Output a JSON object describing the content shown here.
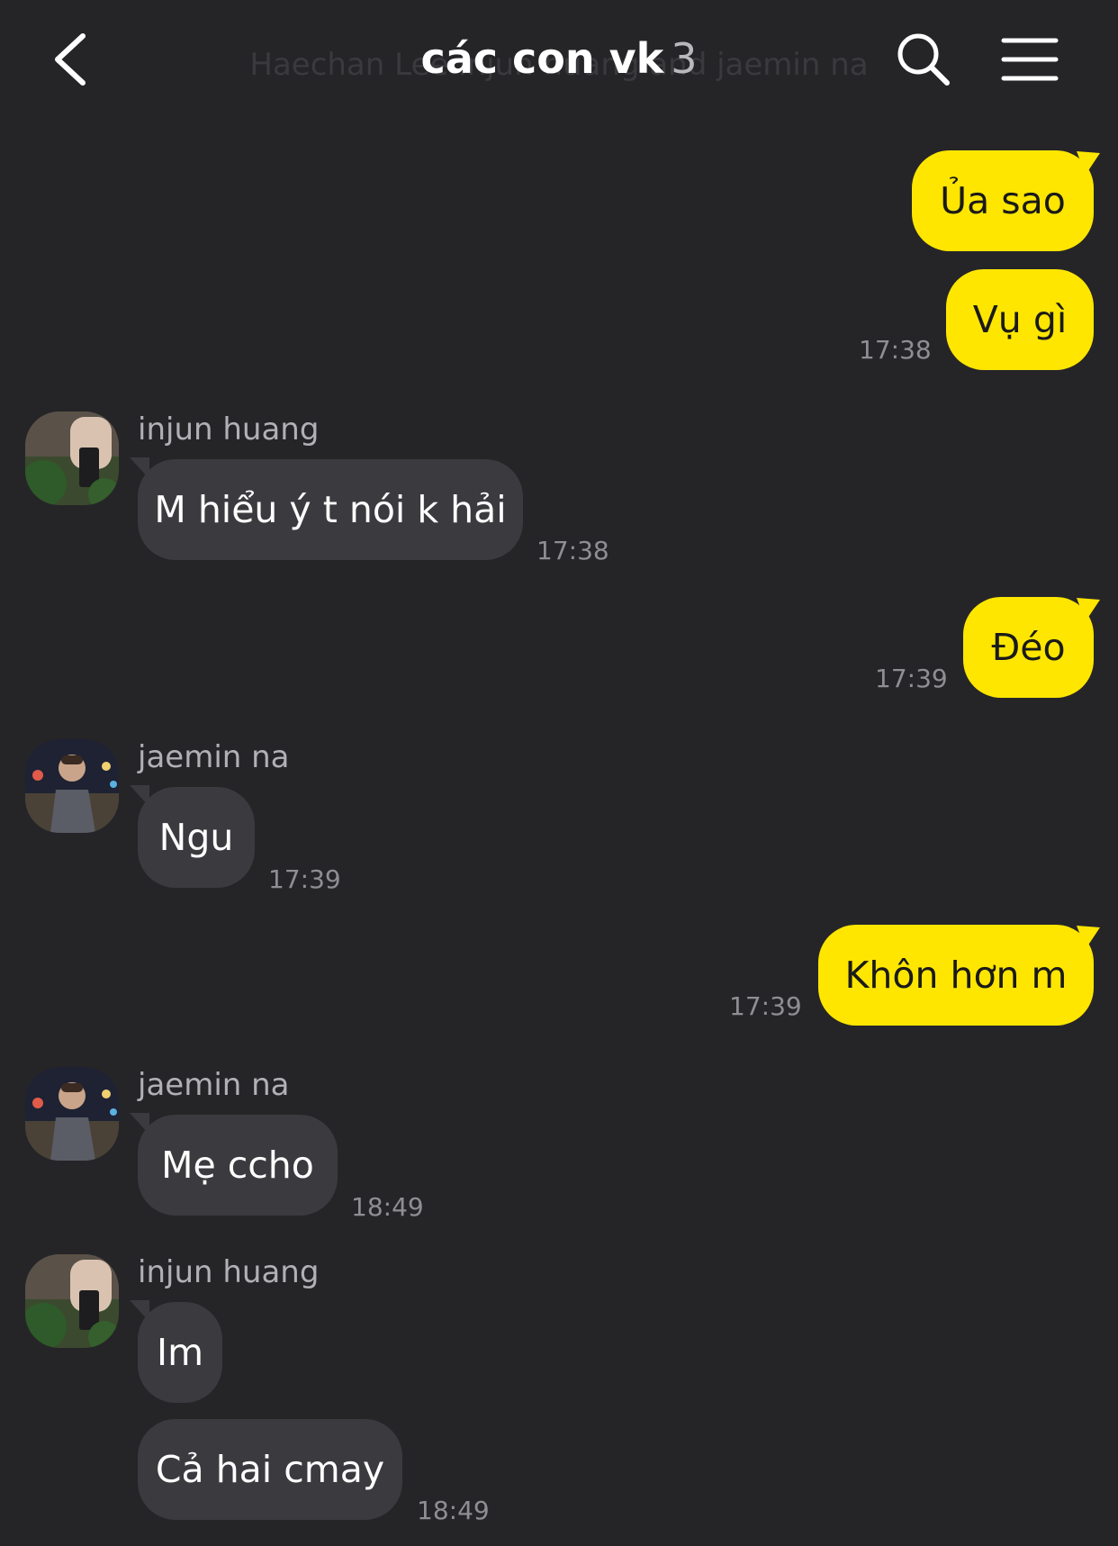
{
  "header": {
    "title": "các con vk",
    "member_count": "3",
    "subtitle": "Haechan Lee injun huang and jaemin na"
  },
  "messages": [
    {
      "text": "Ủa sao"
    },
    {
      "text": "Vụ gì",
      "time": "17:38"
    },
    {
      "sender": "injun huang",
      "text": "M hiểu ý t nói k hải",
      "time": "17:38"
    },
    {
      "text": "Đéo",
      "time": "17:39"
    },
    {
      "sender": "jaemin na",
      "text": "Ngu",
      "time": "17:39"
    },
    {
      "text": "Khôn hơn m",
      "time": "17:39"
    },
    {
      "sender": "jaemin na",
      "text": "Mẹ ccho",
      "time": "18:49"
    },
    {
      "sender": "injun huang",
      "text": "Im"
    },
    {
      "text": "Cả hai cmay",
      "time": "18:49"
    }
  ],
  "colors": {
    "background": "#252528",
    "my_bubble": "#ffe600",
    "their_bubble": "#3b3b3f",
    "timestamp": "#8e8e93"
  },
  "icons": {
    "back": "chevron-left-icon",
    "search": "search-icon",
    "menu": "menu-icon"
  }
}
